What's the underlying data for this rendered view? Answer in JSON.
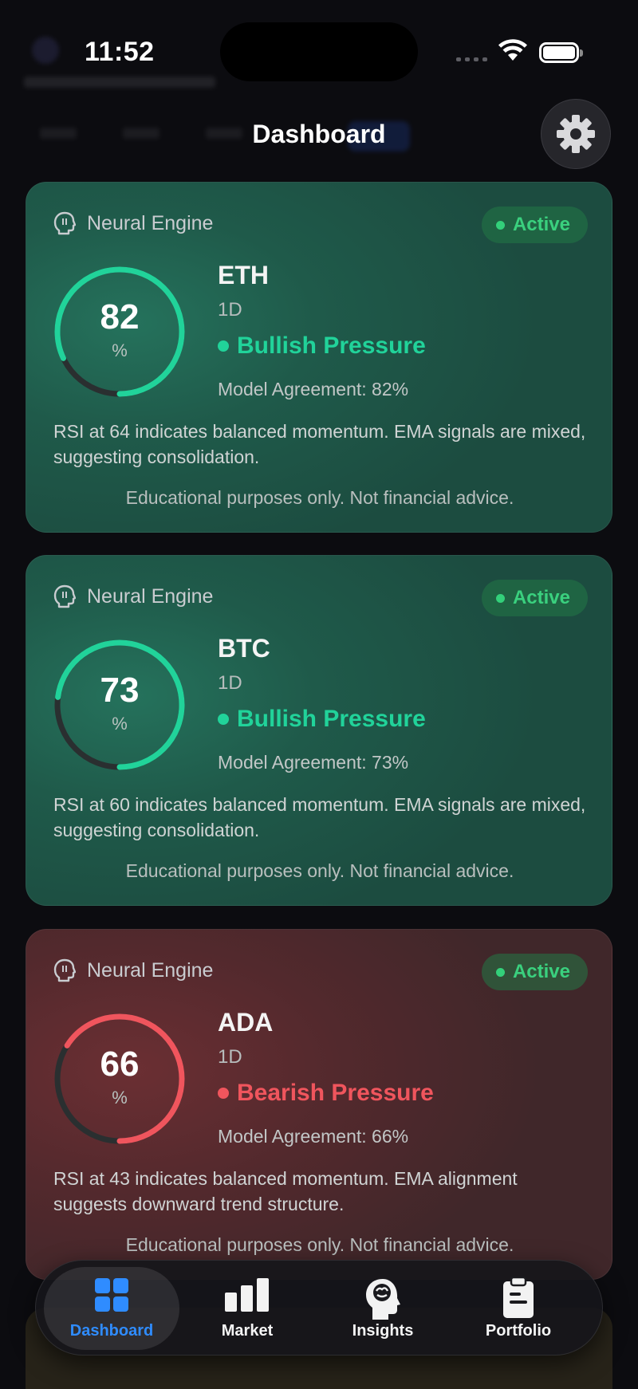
{
  "status_bar": {
    "time": "11:52"
  },
  "header": {
    "title": "Dashboard"
  },
  "cards": [
    {
      "engine_label": "Neural Engine",
      "status": "Active",
      "confidence": "82",
      "unit": "%",
      "asset": "ETH",
      "timeframe": "1D",
      "pressure": "Bullish Pressure",
      "sentiment": "bullish",
      "agreement": "Model Agreement: 82%",
      "description": "RSI at 64 indicates balanced momentum. EMA signals are mixed, suggesting consolidation.",
      "disclaimer": "Educational purposes only. Not financial advice.",
      "gauge_fill": 0.82
    },
    {
      "engine_label": "Neural Engine",
      "status": "Active",
      "confidence": "73",
      "unit": "%",
      "asset": "BTC",
      "timeframe": "1D",
      "pressure": "Bullish Pressure",
      "sentiment": "bullish",
      "agreement": "Model Agreement: 73%",
      "description": "RSI at 60 indicates balanced momentum. EMA signals are mixed, suggesting consolidation.",
      "disclaimer": "Educational purposes only. Not financial advice.",
      "gauge_fill": 0.73
    },
    {
      "engine_label": "Neural Engine",
      "status": "Active",
      "confidence": "66",
      "unit": "%",
      "asset": "ADA",
      "timeframe": "1D",
      "pressure": "Bearish Pressure",
      "sentiment": "bearish",
      "agreement": "Model Agreement: 66%",
      "description": "RSI at 43 indicates balanced momentum. EMA alignment suggests downward trend structure.",
      "disclaimer": "Educational purposes only. Not financial advice.",
      "gauge_fill": 0.66
    }
  ],
  "tab_bar": {
    "tabs": [
      {
        "label": "Dashboard",
        "icon": "grid-icon",
        "selected": true
      },
      {
        "label": "Market",
        "icon": "bar-chart-icon",
        "selected": false
      },
      {
        "label": "Insights",
        "icon": "brain-head-icon",
        "selected": false
      },
      {
        "label": "Portfolio",
        "icon": "clipboard-icon",
        "selected": false
      }
    ]
  },
  "colors": {
    "bullish": "#21d39a",
    "bearish": "#f0555d",
    "active": "#3ad07e",
    "accent": "#2f8cff"
  }
}
